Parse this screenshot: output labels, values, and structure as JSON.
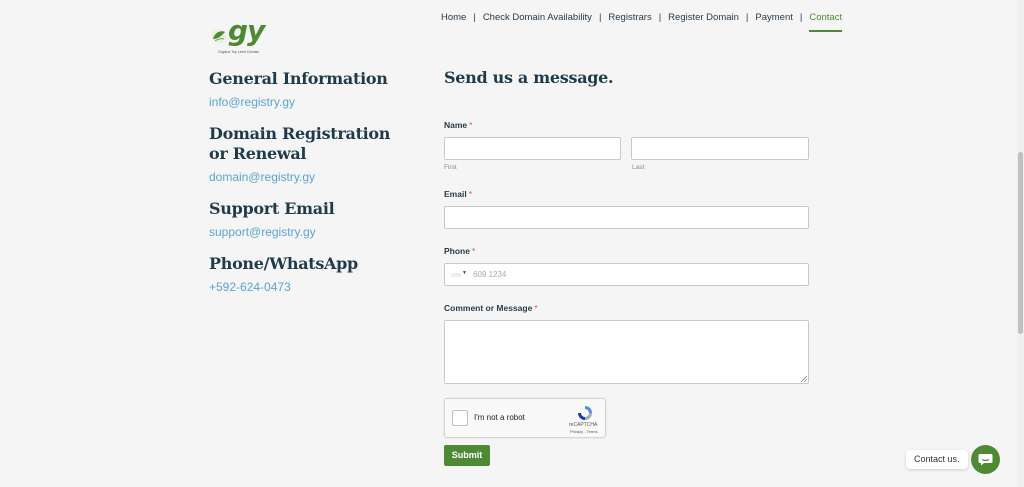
{
  "logo": {
    "word": "gy",
    "tagline": "Guyana Top Level Domain"
  },
  "nav": {
    "items": [
      {
        "label": "Home",
        "active": false
      },
      {
        "label": "Check Domain Availability",
        "active": false
      },
      {
        "label": "Registrars",
        "active": false
      },
      {
        "label": "Register Domain",
        "active": false
      },
      {
        "label": "Payment",
        "active": false
      },
      {
        "label": "Contact",
        "active": true
      }
    ],
    "separator": "|"
  },
  "contacts": {
    "general": {
      "heading": "General Information",
      "email": "info@registry.gy"
    },
    "domain": {
      "heading_line1": "Domain Registration",
      "heading_line2": "or Renewal",
      "email": "domain@registry.gy"
    },
    "support": {
      "heading": "Support Email",
      "email": "support@registry.gy"
    },
    "phone": {
      "heading": "Phone/WhatsApp",
      "number": "+592-624-0473"
    }
  },
  "form": {
    "title": "Send us a message.",
    "required_mark": "*",
    "name": {
      "label": "Name",
      "first_sublabel": "First",
      "last_sublabel": "Last",
      "first_value": "",
      "last_value": ""
    },
    "email": {
      "label": "Email",
      "value": ""
    },
    "phone": {
      "label": "Phone",
      "placeholder": "609 1234",
      "value": ""
    },
    "comment": {
      "label": "Comment or Message",
      "value": ""
    },
    "recaptcha": {
      "text": "I'm not a robot",
      "brand": "reCAPTCHA",
      "links": "Privacy - Terms",
      "checked": false
    },
    "submit_label": "Submit"
  },
  "chat": {
    "label": "Contact us."
  },
  "colors": {
    "accent": "#4e8a34",
    "link": "#5ba4cf",
    "heading": "#1f3a4a",
    "required": "#d9534f"
  }
}
